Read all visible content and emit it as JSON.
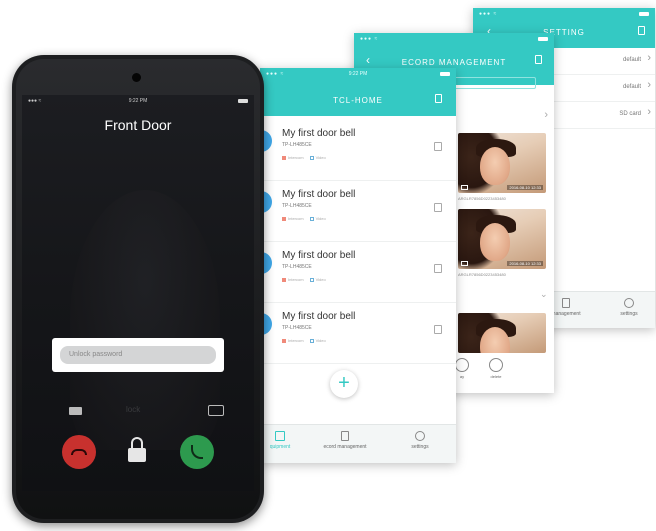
{
  "settings_screen": {
    "title": "SETTING",
    "rows": [
      {
        "value": "default"
      },
      {
        "value": "default"
      },
      {
        "value": "SD card"
      }
    ]
  },
  "record_screen": {
    "title": "ECORD MANAGEMENT",
    "records": [
      {
        "id": "ARGLR7856D0223453480",
        "stamp": "2016-08-10 12:33"
      },
      {
        "id": "ARGLR7856D0223453480",
        "stamp": "2016-08-10 12:33"
      }
    ],
    "actions": [
      {
        "label": "ay"
      },
      {
        "label": "delete"
      }
    ]
  },
  "home_screen": {
    "title": "TCL-HOME",
    "time": "9:22 PM",
    "devices": [
      {
        "name": "My first door bell",
        "model": "TP-LH485CE",
        "tag_a": "Intercom",
        "tag_b": "Video"
      },
      {
        "name": "My first door bell",
        "model": "TP-LH485CE",
        "tag_a": "Intercom",
        "tag_b": "Video"
      },
      {
        "name": "My first door bell",
        "model": "TP-LH485CE",
        "tag_a": "Intercom",
        "tag_b": "Video"
      },
      {
        "name": "My first door bell",
        "model": "TP-LH485CE",
        "tag_a": "Intercom",
        "tag_b": "Video"
      }
    ],
    "add_symbol": "+",
    "tabs": [
      {
        "label": "quipment"
      },
      {
        "label": "ecord management"
      },
      {
        "label": "settings"
      }
    ],
    "side_tabs": [
      {
        "label": "management"
      },
      {
        "label": "settings"
      }
    ]
  },
  "phone": {
    "time": "9:22 PM",
    "caller": "Front Door",
    "password_placeholder": "Unlock password",
    "middle_label": "lock",
    "colors": {
      "hangup": "#c8312e",
      "answer": "#2d9a4e",
      "accent": "#34c9c3"
    }
  }
}
